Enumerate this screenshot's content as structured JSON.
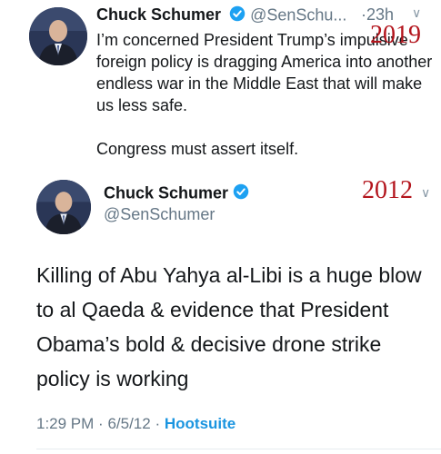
{
  "tweet_1": {
    "display_name": "Chuck Schumer",
    "handle": "@SenSchu...",
    "separator": "·",
    "time": "23h",
    "caret": "∨",
    "paragraphs": [
      "I’m concerned President Trump’s impulsive foreign policy is dragging America into another endless war in the Middle East that will make us less safe.",
      "Congress must assert itself."
    ]
  },
  "tweet_2": {
    "display_name": "Chuck Schumer",
    "handle": "@SenSchumer",
    "caret": "∨",
    "text": "Killing of Abu Yahya al-Libi is a huge blow to al Qaeda & evidence that President Obama’s bold & decisive drone strike policy is working",
    "time": "1:29 PM",
    "separator": "·",
    "date": "6/5/12",
    "separator_2": "·",
    "source": "Hootsuite"
  },
  "annotations": {
    "year_top": "2019",
    "year_bottom": "2012"
  },
  "colors": {
    "verified_badge": "#1da1f2",
    "link": "#1b95e0",
    "annotation": "#b3141c",
    "muted_text": "#657786"
  },
  "icons": {
    "verified": "verified-badge-icon",
    "caret": "chevron-down-icon",
    "avatar": "profile-photo"
  }
}
